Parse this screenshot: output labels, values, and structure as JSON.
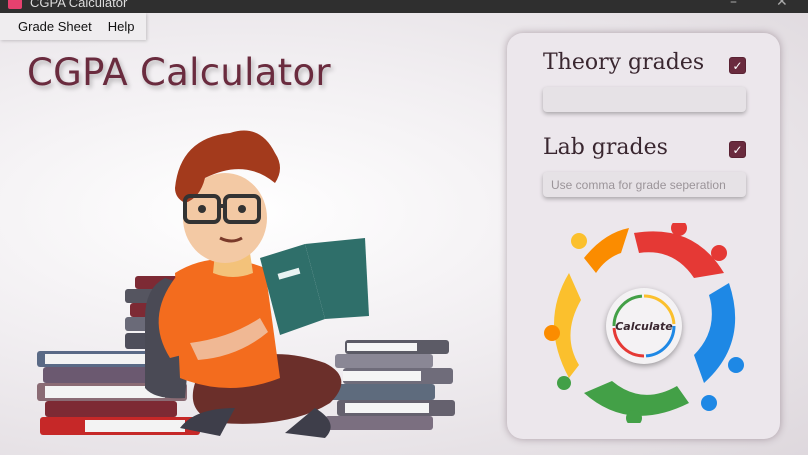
{
  "window": {
    "title": "CGPA Calculator"
  },
  "menu": {
    "items": [
      "Grade Sheet",
      "Help"
    ]
  },
  "app_title": "CGPA Calculator",
  "panel": {
    "theory": {
      "label": "Theory grades",
      "checked": true,
      "value": "",
      "placeholder": ""
    },
    "lab": {
      "label": "Lab grades",
      "checked": true,
      "value": "",
      "placeholder": "Use comma for grade seperation"
    },
    "calculate_label": "Calculate"
  },
  "colors": {
    "accent": "#6a2b3e",
    "background": "#f1eef1",
    "panel": "#ece7ec",
    "wheel": [
      "#e53935",
      "#1e88e5",
      "#43a047",
      "#fbc02d",
      "#fb8c00",
      "#8e24aa"
    ]
  }
}
